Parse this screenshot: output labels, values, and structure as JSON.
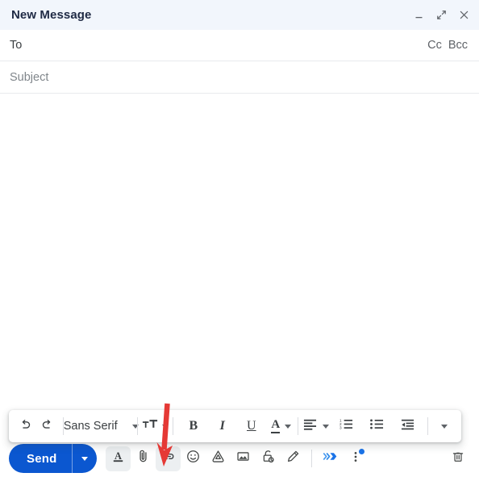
{
  "window": {
    "title": "New Message",
    "controls": [
      {
        "name": "minimize",
        "label": "–",
        "icon": "minimize-icon"
      },
      {
        "name": "expand",
        "label": "",
        "icon": "expand-icon"
      },
      {
        "name": "close",
        "label": "×",
        "icon": "close-icon"
      }
    ]
  },
  "fields": {
    "to": {
      "label": "To",
      "value": "",
      "placeholder": "To"
    },
    "cc": {
      "label": "Cc"
    },
    "bcc": {
      "label": "Bcc"
    },
    "subject": {
      "label": "Subject",
      "value": "",
      "placeholder": "Subject"
    },
    "body": {
      "value": "",
      "placeholder": ""
    }
  },
  "body_overlay": {
    "spinner": {
      "name": "loading-spinner",
      "color": "#c3a85e",
      "visible": true
    }
  },
  "format_toolbar": {
    "undo": {
      "label": "",
      "icon": "undo-icon",
      "tooltip": "Undo"
    },
    "redo": {
      "label": "",
      "icon": "redo-icon",
      "tooltip": "Redo"
    },
    "font_family": {
      "value": "Sans Serif",
      "icon": "chevron-down-icon"
    },
    "font_size": {
      "label": "",
      "icon": "font-size-icon"
    },
    "bold": {
      "label": "B",
      "icon": "bold-icon"
    },
    "italic": {
      "label": "I",
      "icon": "italic-icon"
    },
    "underline": {
      "label": "U",
      "icon": "underline-icon"
    },
    "text_color": {
      "label": "A",
      "icon": "text-color-icon"
    },
    "align": {
      "label": "",
      "icon": "align-left-icon"
    },
    "numbered_list": {
      "label": "",
      "icon": "numbered-list-icon"
    },
    "bulleted_list": {
      "label": "",
      "icon": "bulleted-list-icon"
    },
    "indent": {
      "label": "",
      "icon": "indent-less-icon"
    },
    "more": {
      "label": "",
      "icon": "chevron-down-icon"
    }
  },
  "action_bar": {
    "send": {
      "label": "Send",
      "color": "#0b57d0",
      "text_color": "#ffffff"
    },
    "send_options": {
      "label": "",
      "icon": "chevron-down-icon"
    },
    "icons": [
      {
        "name": "formatting-options-button",
        "icon": "format-text-icon",
        "label": "A",
        "active": true
      },
      {
        "name": "attach-file-button",
        "icon": "paperclip-icon",
        "label": "",
        "active": false
      },
      {
        "name": "insert-link-button",
        "icon": "link-icon",
        "label": "",
        "active": true
      },
      {
        "name": "insert-emoji-button",
        "icon": "emoji-icon",
        "label": "",
        "active": false
      },
      {
        "name": "insert-drive-file-button",
        "icon": "google-drive-icon",
        "label": "",
        "active": false
      },
      {
        "name": "insert-photo-button",
        "icon": "image-icon",
        "label": "",
        "active": false
      },
      {
        "name": "confidential-mode-button",
        "icon": "lock-clock-icon",
        "label": "",
        "active": false
      },
      {
        "name": "insert-signature-button",
        "icon": "pen-icon",
        "label": "",
        "active": false
      }
    ],
    "gemini": {
      "name": "help-me-write-button",
      "icon": "gemini-chevrons-icon",
      "color": "#1a73e8"
    },
    "more_options": {
      "name": "more-options-button",
      "icon": "more-vert-icon",
      "badge_color": "#1a73e8",
      "badge": true
    },
    "discard": {
      "name": "discard-draft-button",
      "icon": "trash-icon",
      "label": ""
    }
  },
  "annotation": {
    "arrow": {
      "name": "annotation-arrow",
      "color": "#e53935",
      "points_to": "insert-link-button"
    }
  }
}
